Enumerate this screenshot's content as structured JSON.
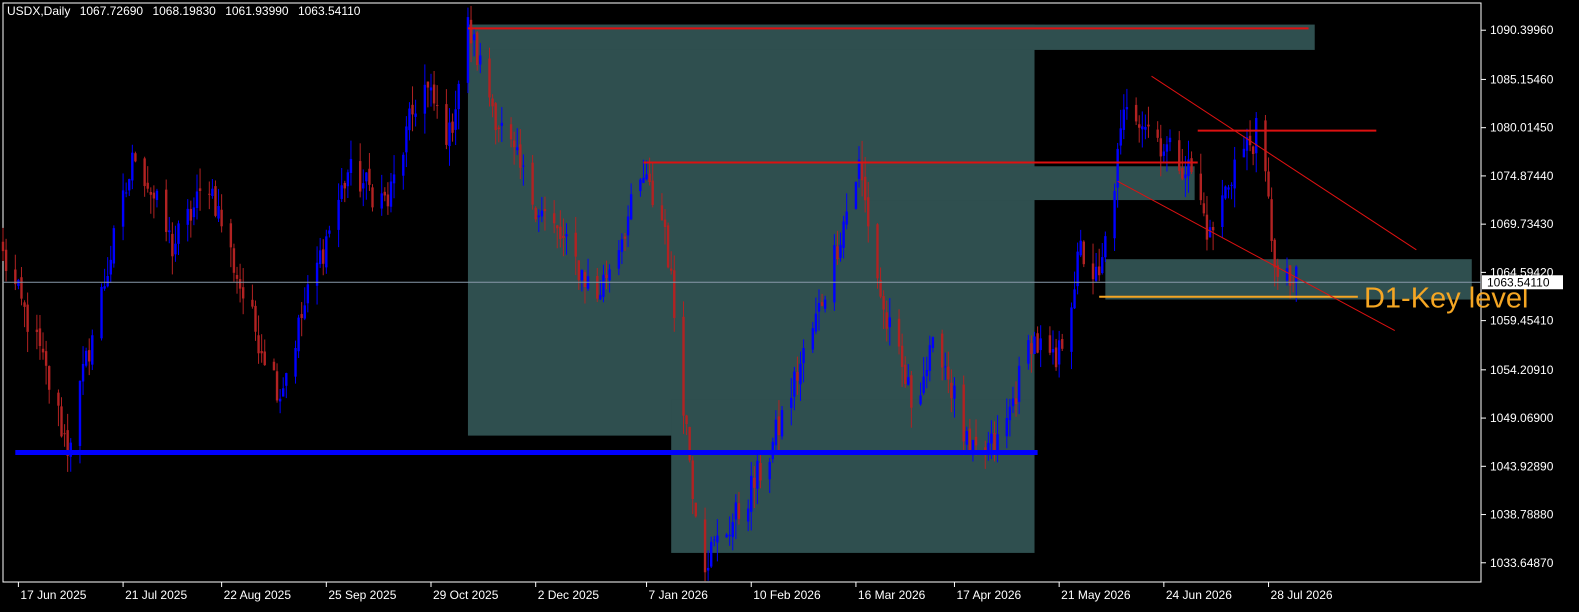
{
  "header": {
    "symbol": "USDX,Daily",
    "open": "1067.72690",
    "high": "1068.19830",
    "low": "1061.93990",
    "close": "1063.54110"
  },
  "chart_data": {
    "type": "candlestick",
    "symbol": "USDX",
    "timeframe": "Daily",
    "ylim": [
      1031.6,
      1093.3
    ],
    "y_ticks": [
      "1090.39960",
      "1085.15460",
      "1080.01450",
      "1074.87440",
      "1069.73430",
      "1064.59420",
      "1059.45410",
      "1054.20910",
      "1049.06900",
      "1043.92890",
      "1038.78880",
      "1033.64870"
    ],
    "x_ticks": [
      "17 Jun 2025",
      "21 Jul 2025",
      "22 Aug 2025",
      "25 Sep 2025",
      "29 Oct 2025",
      "2 Dec 2025",
      "7 Jan 2026",
      "10 Feb 2026",
      "16 Mar 2026",
      "17 Apr 2026",
      "21 May 2026",
      "24 Jun 2026",
      "28 Jul 2026"
    ],
    "x_range": [
      "2025-06-12",
      "2026-10-05"
    ],
    "current_price": "1063.54110",
    "colors": {
      "bull": "#0000ff",
      "bear": "#b22222",
      "zone": "#2f4f4f",
      "resistance": "#dd1111",
      "support": "#0000ff",
      "key_level": "#f5a623",
      "grid_price_line": "#8899aa"
    },
    "anchors": [
      {
        "date": "2025-06-12",
        "price": 1066.3
      },
      {
        "date": "2025-06-24",
        "price": 1056.0
      },
      {
        "date": "2025-07-03",
        "price": 1046.0
      },
      {
        "date": "2025-07-11",
        "price": 1058.0
      },
      {
        "date": "2025-07-25",
        "price": 1077.6
      },
      {
        "date": "2025-08-06",
        "price": 1067.3
      },
      {
        "date": "2025-08-18",
        "price": 1074.3
      },
      {
        "date": "2025-08-30",
        "price": 1061.0
      },
      {
        "date": "2025-09-10",
        "price": 1051.9
      },
      {
        "date": "2025-09-20",
        "price": 1063.2
      },
      {
        "date": "2025-10-02",
        "price": 1075.3
      },
      {
        "date": "2025-10-15",
        "price": 1072.0
      },
      {
        "date": "2025-10-26",
        "price": 1085.0
      },
      {
        "date": "2025-11-04",
        "price": 1079.0
      },
      {
        "date": "2025-11-10",
        "price": 1090.7
      },
      {
        "date": "2025-11-20",
        "price": 1080.5
      },
      {
        "date": "2025-12-01",
        "price": 1072.5
      },
      {
        "date": "2025-12-10",
        "price": 1068.2
      },
      {
        "date": "2025-12-22",
        "price": 1062.0
      },
      {
        "date": "2026-01-06",
        "price": 1074.6
      },
      {
        "date": "2026-01-13",
        "price": 1069.5
      },
      {
        "date": "2026-01-22",
        "price": 1041.9
      },
      {
        "date": "2026-01-26",
        "price": 1034.0
      },
      {
        "date": "2026-02-06",
        "price": 1039.0
      },
      {
        "date": "2026-02-16",
        "price": 1045.3
      },
      {
        "date": "2026-03-03",
        "price": 1059.5
      },
      {
        "date": "2026-03-17",
        "price": 1075.9
      },
      {
        "date": "2026-03-25",
        "price": 1060.3
      },
      {
        "date": "2026-04-03",
        "price": 1051.0
      },
      {
        "date": "2026-04-12",
        "price": 1057.4
      },
      {
        "date": "2026-04-22",
        "price": 1044.8
      },
      {
        "date": "2026-05-02",
        "price": 1046.5
      },
      {
        "date": "2026-05-12",
        "price": 1057.6
      },
      {
        "date": "2026-05-20",
        "price": 1054.4
      },
      {
        "date": "2026-05-28",
        "price": 1066.9
      },
      {
        "date": "2026-06-03",
        "price": 1063.3
      },
      {
        "date": "2026-06-12",
        "price": 1083.2
      },
      {
        "date": "2026-06-24",
        "price": 1078.1
      },
      {
        "date": "2026-07-03",
        "price": 1075.3
      },
      {
        "date": "2026-07-09",
        "price": 1068.3
      },
      {
        "date": "2026-07-17",
        "price": 1076.3
      },
      {
        "date": "2026-07-25",
        "price": 1079.7
      },
      {
        "date": "2026-07-31",
        "price": 1063.5
      },
      {
        "date": "2026-08-06",
        "price": 1063.5
      }
    ],
    "zones": [
      {
        "x1": "2025-11-10",
        "x2": "2026-05-13",
        "y1": 1047.2,
        "y2": 1091.0
      },
      {
        "x1": "2025-11-10",
        "x2": "2026-08-12",
        "y1": 1088.3,
        "y2": 1091.0
      },
      {
        "x1": "2026-03-20",
        "x2": "2026-07-04",
        "y1": 1072.3,
        "y2": 1075.9
      },
      {
        "x1": "2026-01-15",
        "x2": "2026-05-13",
        "y1": 1034.7,
        "y2": 1051.1
      },
      {
        "x1": "2026-06-05",
        "x2": "2026-10-02",
        "y1": 1061.7,
        "y2": 1066.0
      }
    ],
    "lines": [
      {
        "x1": "2025-11-10",
        "y1": 1090.6,
        "x2": "2026-08-10",
        "y2": 1090.6,
        "color": "#dd1111",
        "width": 2
      },
      {
        "x1": "2026-01-06",
        "y1": 1076.3,
        "x2": "2026-07-05",
        "y2": 1076.3,
        "color": "#dd1111",
        "width": 2
      },
      {
        "x1": "2026-07-05",
        "y1": 1079.7,
        "x2": "2026-09-01",
        "y2": 1079.7,
        "color": "#dd1111",
        "width": 2
      },
      {
        "x1": "2025-06-16",
        "y1": 1045.4,
        "x2": "2026-05-14",
        "y2": 1045.4,
        "color": "#0000ff",
        "width": 5
      },
      {
        "x1": "2026-06-03",
        "y1": 1062.0,
        "x2": "2026-08-26",
        "y2": 1062.0,
        "color": "#f5a623",
        "width": 2
      },
      {
        "x1": "2026-06-20",
        "y1": 1085.5,
        "x2": "2026-09-14",
        "y2": 1067.0,
        "color": "#dd1111",
        "width": 1
      },
      {
        "x1": "2026-06-09",
        "y1": 1074.3,
        "x2": "2026-09-07",
        "y2": 1058.4,
        "color": "#dd1111",
        "width": 1
      }
    ],
    "annotations": [
      {
        "text": "D1-Key level",
        "date": "2026-08-28",
        "price": 1061.9
      }
    ]
  }
}
